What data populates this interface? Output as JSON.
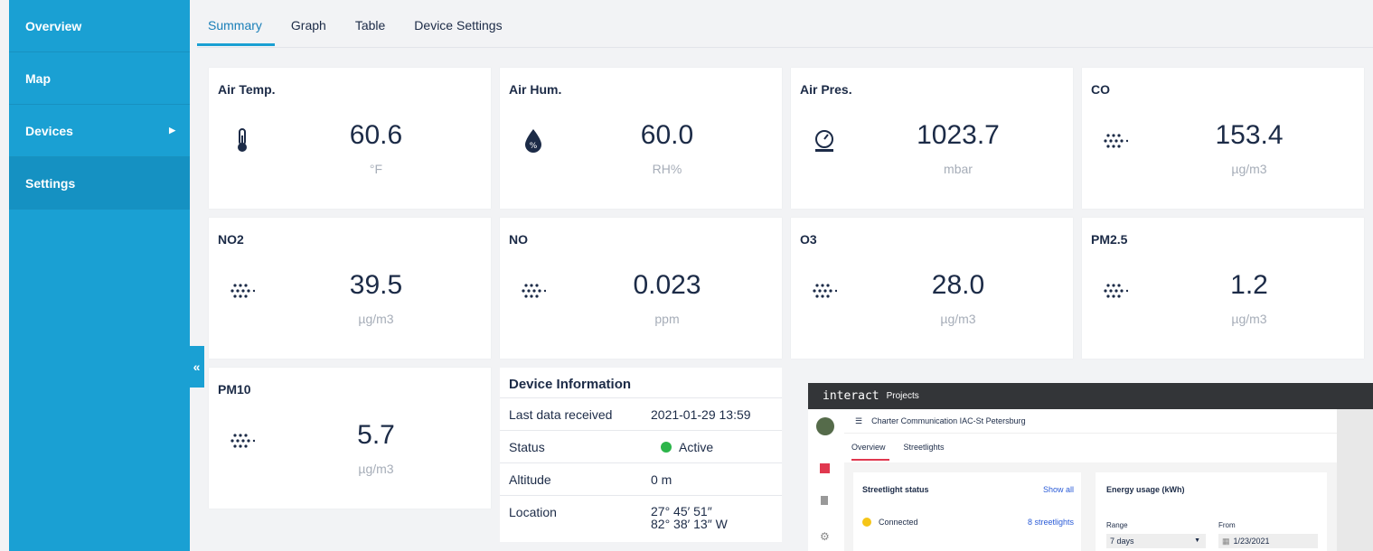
{
  "sidebar": {
    "items": [
      {
        "label": "Overview"
      },
      {
        "label": "Map"
      },
      {
        "label": "Devices"
      },
      {
        "label": "Settings"
      }
    ],
    "collapse_glyph": "«"
  },
  "tabs": [
    "Summary",
    "Graph",
    "Table",
    "Device Settings"
  ],
  "cards": [
    {
      "title": "Air Temp.",
      "value": "60.6",
      "unit": "°F",
      "icon": "thermometer-icon"
    },
    {
      "title": "Air Hum.",
      "value": "60.0",
      "unit": "RH%",
      "icon": "humidity-drop-icon"
    },
    {
      "title": "Air Pres.",
      "value": "1023.7",
      "unit": "mbar",
      "icon": "pressure-gauge-icon"
    },
    {
      "title": "CO",
      "value": "153.4",
      "unit": "µg/m3",
      "icon": "particles-icon"
    },
    {
      "title": "NO2",
      "value": "39.5",
      "unit": "µg/m3",
      "icon": "particles-icon"
    },
    {
      "title": "NO",
      "value": "0.023",
      "unit": "ppm",
      "icon": "particles-icon"
    },
    {
      "title": "O3",
      "value": "28.0",
      "unit": "µg/m3",
      "icon": "particles-icon"
    },
    {
      "title": "PM2.5",
      "value": "1.2",
      "unit": "µg/m3",
      "icon": "particles-icon"
    },
    {
      "title": "PM10",
      "value": "5.7",
      "unit": "µg/m3",
      "icon": "particles-icon"
    }
  ],
  "device_info": {
    "title": "Device Information",
    "rows": [
      {
        "label": "Last data received",
        "value": "2021-01-29 13:59"
      },
      {
        "label": "Status",
        "value": "Active"
      },
      {
        "label": "Altitude",
        "value": "0 m"
      },
      {
        "label": "Location",
        "value": "27° 45′ 51″",
        "value2": "82° 38′ 13″ W"
      }
    ],
    "status_color": "#2cb54a"
  },
  "inset": {
    "logo": "interact",
    "nav": "Projects",
    "project": "Charter Communication IAC-St Petersburg",
    "tabs": [
      "Overview",
      "Streetlights"
    ],
    "status_panel": {
      "title": "Streetlight status",
      "show_all": "Show all",
      "connected": "Connected",
      "count": "8 streetlights"
    },
    "energy_panel": {
      "title": "Energy usage (kWh)",
      "range_label": "Range",
      "range_value": "7 days",
      "from_label": "From",
      "from_value": "1/23/2021"
    }
  },
  "colors": {
    "sidebar": "#1aa0d3",
    "accent": "#1aa0d3",
    "status_active": "#2cb54a",
    "inset_accent": "#e0384f"
  }
}
